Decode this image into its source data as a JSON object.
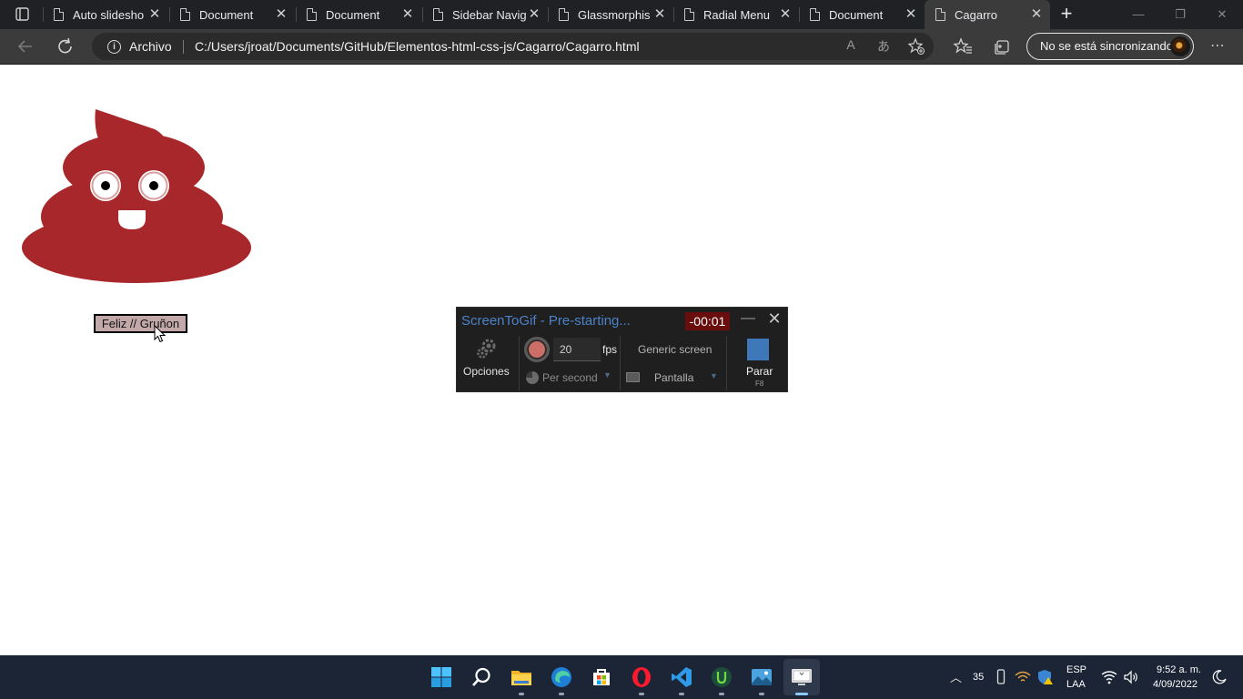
{
  "browser": {
    "tabs": [
      {
        "title": "Auto slidesho",
        "active": false
      },
      {
        "title": "Document",
        "active": false
      },
      {
        "title": "Document",
        "active": false
      },
      {
        "title": "Sidebar Navig",
        "active": false
      },
      {
        "title": "Glassmorphis",
        "active": false
      },
      {
        "title": "Radial Menu",
        "active": false
      },
      {
        "title": "Document",
        "active": false
      },
      {
        "title": "Cagarro",
        "active": true
      }
    ],
    "site_label": "Archivo",
    "url": "C:/Users/jroat/Documents/GitHub/Elementos-html-css-js/Cagarro/Cagarro.html",
    "sync_label": "No se está sincronizando"
  },
  "page": {
    "toggle_button_label": "Feliz // Gruñon",
    "poop_color": "#a8272a"
  },
  "screentogif": {
    "title": "ScreenToGif - Pre-starting...",
    "countdown": "-00:01",
    "options_label": "Opciones",
    "fps_value": "20",
    "fps_label": "fps",
    "frequency_label": "Per second",
    "mode_label": "Generic screen",
    "screen_label": "Pantalla",
    "stop_label": "Parar",
    "stop_shortcut": "F8"
  },
  "taskbar": {
    "apps": [
      "start-icon",
      "search-icon",
      "file-explorer-icon",
      "edge-icon",
      "store-icon",
      "opera-icon",
      "vscode-icon",
      "upwork-icon",
      "photos-icon",
      "screentogif-icon"
    ],
    "temperature": "35",
    "language": "ESP",
    "keyboard_layout": "LAA",
    "time": "9:52 a. m.",
    "date": "4/09/2022"
  }
}
